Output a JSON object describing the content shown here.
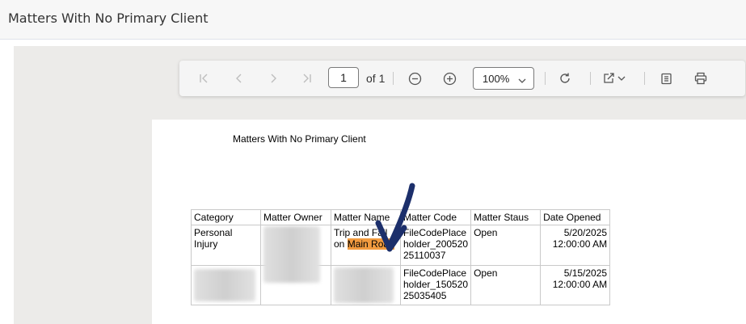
{
  "header": {
    "title": "Matters With No Primary Client"
  },
  "toolbar": {
    "page_value": "1",
    "page_total": "of 1",
    "zoom": "100%"
  },
  "report": {
    "title": "Matters With No Primary Client",
    "columns": [
      "Category",
      "Matter Owner",
      "Matter Name",
      "Matter Code",
      "Matter Staus",
      "Date Opened"
    ],
    "rows": [
      {
        "category": "Personal Injury",
        "name_line1": "Trip and Fall",
        "name_line2_prefix": "on",
        "name_highlight": "Main Road",
        "code": [
          "FileCodePlace",
          "holder_200520",
          "25110037"
        ],
        "status": "Open",
        "date": "5/20/2025",
        "time": "12:00:00 AM"
      },
      {
        "code": [
          "FileCodePlace",
          "holder_150520",
          "25035405"
        ],
        "status": "Open",
        "date": "5/15/2025",
        "time": "12:00:00 AM"
      }
    ]
  },
  "colors": {
    "highlight": "#f29b3f",
    "arrow": "#1c2f6b"
  }
}
